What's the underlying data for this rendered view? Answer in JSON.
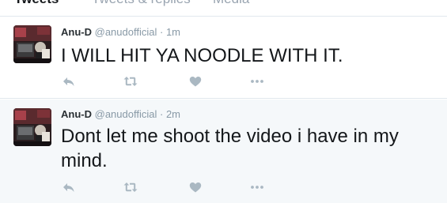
{
  "tabs": [
    {
      "label": "Tweets",
      "active": true
    },
    {
      "label": "Tweets & replies",
      "active": false
    },
    {
      "label": "Media",
      "active": false
    }
  ],
  "tweets": [
    {
      "name": "Anu-D",
      "handle": "@anudofficial",
      "separator": "·",
      "time": "1m",
      "text": "I WILL HIT YA NOODLE WITH IT."
    },
    {
      "name": "Anu-D",
      "handle": "@anudofficial",
      "separator": "·",
      "time": "2m",
      "text": "Dont let me shoot the video i have in my mind."
    }
  ],
  "icons": {
    "reply": "reply-icon",
    "retweet": "retweet-icon",
    "like": "heart-icon",
    "more": "more-dots-icon"
  },
  "colors": {
    "icon_gray": "#aab8c2",
    "secondary_text": "#8899a6",
    "highlight_row_bg": "#f5f8fa"
  }
}
